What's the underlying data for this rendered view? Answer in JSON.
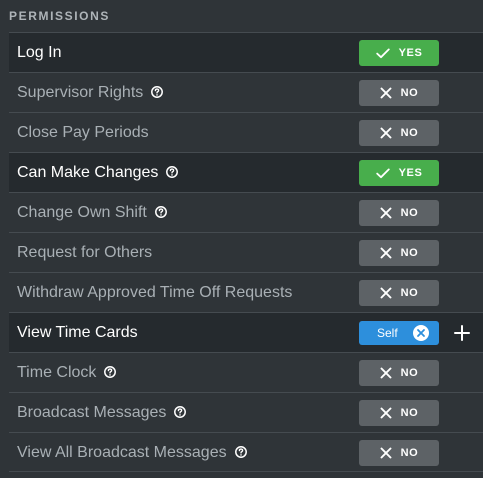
{
  "header": {
    "title": "PERMISSIONS"
  },
  "permissions": [
    {
      "label": "Log In",
      "value": "YES",
      "help": false
    },
    {
      "label": "Supervisor Rights",
      "value": "NO",
      "help": true
    },
    {
      "label": "Close Pay Periods",
      "value": "NO",
      "help": false
    },
    {
      "label": "Can Make Changes",
      "value": "YES",
      "help": true
    },
    {
      "label": "Change Own Shift",
      "value": "NO",
      "help": true
    },
    {
      "label": "Request for Others",
      "value": "NO",
      "help": false
    },
    {
      "label": "Withdraw Approved Time Off Requests",
      "value": "NO",
      "help": false
    },
    {
      "label": "View Time Cards",
      "value": "Self",
      "help": false,
      "chip": true
    },
    {
      "label": "Time Clock",
      "value": "NO",
      "help": true
    },
    {
      "label": "Broadcast Messages",
      "value": "NO",
      "help": true
    },
    {
      "label": "View All Broadcast Messages",
      "value": "NO",
      "help": true
    }
  ],
  "colors": {
    "yes": "#48ae4c",
    "no": "#5d6266",
    "chip": "#2d8fdc"
  }
}
